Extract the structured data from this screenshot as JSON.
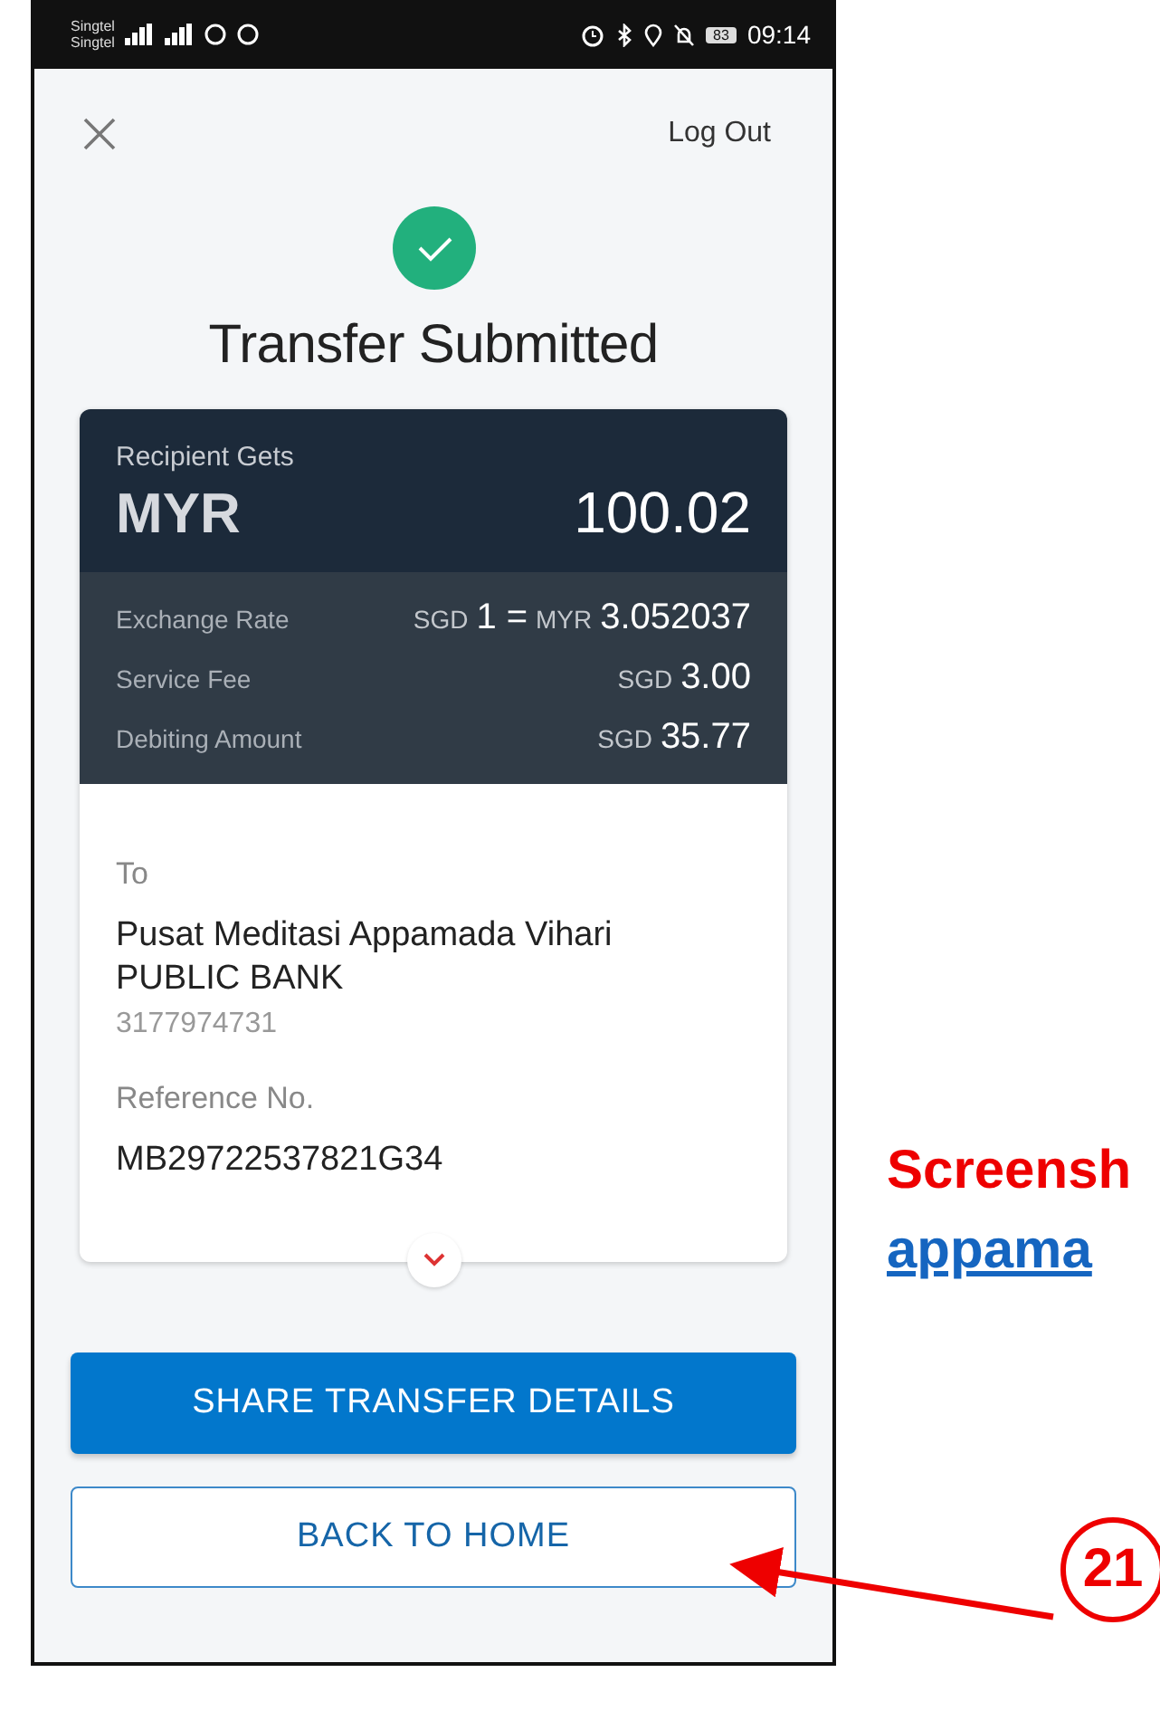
{
  "status_bar": {
    "carriers": [
      "Singtel",
      "Singtel"
    ],
    "battery": "83",
    "time": "09:14"
  },
  "header": {
    "action": "Log Out"
  },
  "title": "Transfer Submitted",
  "summary": {
    "label": "Recipient Gets",
    "currency": "MYR",
    "amount": "100.02"
  },
  "details": [
    {
      "label": "Exchange Rate",
      "parts": [
        {
          "kind": "unit",
          "text": "SGD"
        },
        {
          "kind": "number",
          "text": "1 ="
        },
        {
          "kind": "unit",
          "text": "MYR"
        },
        {
          "kind": "number",
          "text": "3.052037"
        }
      ]
    },
    {
      "label": "Service Fee",
      "parts": [
        {
          "kind": "unit",
          "text": "SGD"
        },
        {
          "kind": "number",
          "text": "3.00"
        }
      ]
    },
    {
      "label": "Debiting Amount",
      "parts": [
        {
          "kind": "unit",
          "text": "SGD"
        },
        {
          "kind": "number",
          "text": "35.77"
        }
      ]
    }
  ],
  "recipient": {
    "label": "To",
    "name": "Pusat Meditasi Appamada Vihari",
    "bank": "PUBLIC BANK",
    "account": "3177974731"
  },
  "reference": {
    "label": "Reference No.",
    "value": "MB29722537821G34"
  },
  "buttons": [
    {
      "kind": "primary",
      "label": "SHARE TRANSFER DETAILS"
    },
    {
      "kind": "outline",
      "label": "BACK TO HOME"
    }
  ],
  "annotation": {
    "caption": "Screensh",
    "link": "appama",
    "step": "21"
  }
}
